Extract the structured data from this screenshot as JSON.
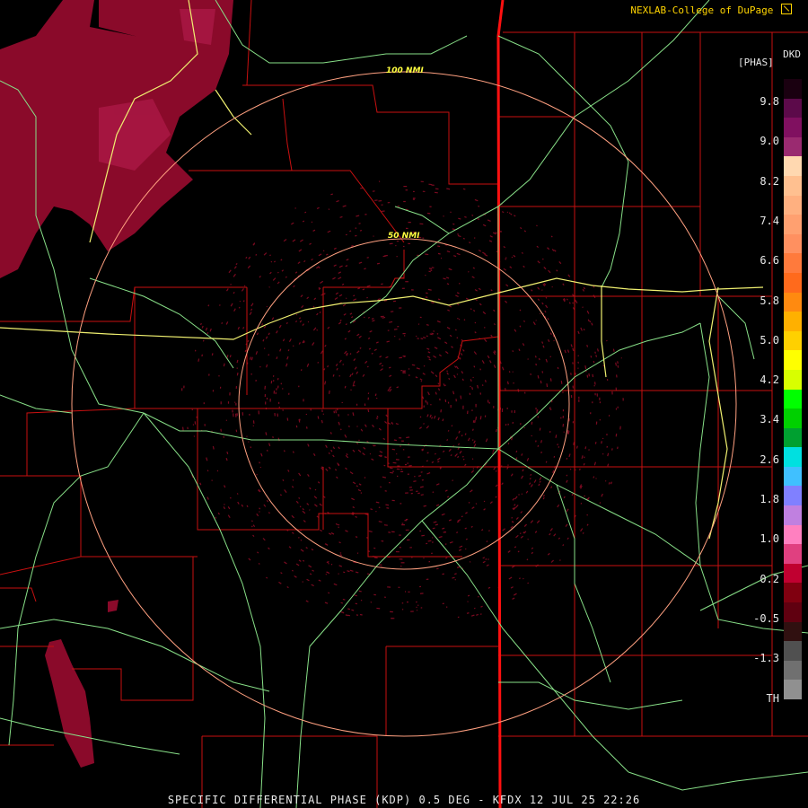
{
  "credit": {
    "text": "NEXLAB-College of DuPage",
    "icon": "expand-icon"
  },
  "product_code": "DKD",
  "units": "[PHAS]",
  "scale_labels": [
    "9.8",
    "9.0",
    "8.2",
    "7.4",
    "6.6",
    "5.8",
    "5.0",
    "4.2",
    "3.4",
    "2.6",
    "1.8",
    "1.0",
    "0.2",
    "-0.5",
    "-1.3",
    "TH"
  ],
  "scale_colors": [
    "#1a0010",
    "#5c0a4a",
    "#801060",
    "#9a2a70",
    "#ffd8b0",
    "#ffc090",
    "#ffb080",
    "#ffa070",
    "#ff9060",
    "#ff7a3c",
    "#ff6a1c",
    "#ff8a10",
    "#ffb000",
    "#ffd000",
    "#ffff00",
    "#d8ff00",
    "#00ff00",
    "#00d000",
    "#00a030",
    "#00e0e0",
    "#40c0ff",
    "#8080ff",
    "#c080e0",
    "#ff80c0",
    "#e04080",
    "#c00030",
    "#800010",
    "#600010",
    "#301010",
    "#505050",
    "#707070",
    "#909090",
    "#000000"
  ],
  "ring_labels": {
    "inner": "50 NMI",
    "outer": "100 NMI"
  },
  "footer": "SPECIFIC DIFFERENTIAL PHASE (KDP) 0.5 DEG - KFDX 12 JUL 25 22:26",
  "colors": {
    "county_border": "#d01010",
    "state_border": "#ff1010",
    "highway": "#90e890",
    "interstate": "#ffff80",
    "range_ring": "#ffa080",
    "echo": "#8b0a2a"
  }
}
